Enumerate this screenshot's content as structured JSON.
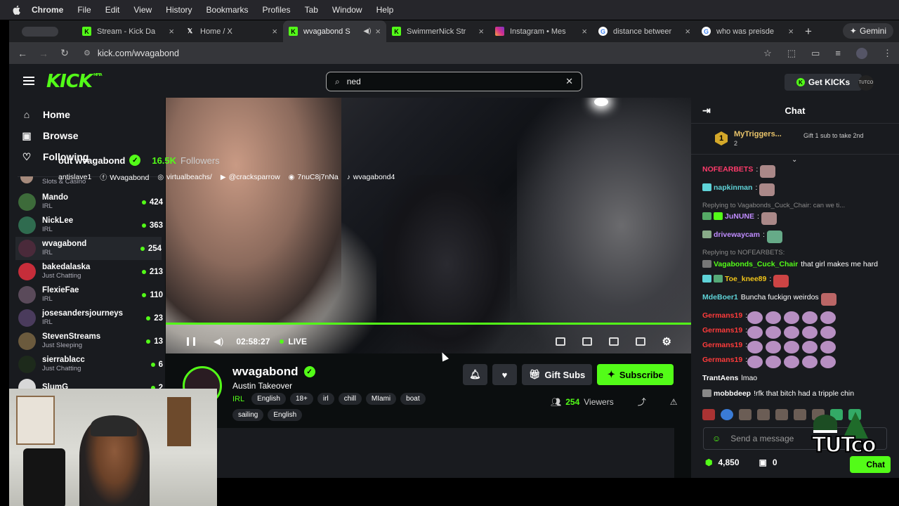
{
  "menubar": {
    "app": "Chrome",
    "items": [
      "File",
      "Edit",
      "View",
      "History",
      "Bookmarks",
      "Profiles",
      "Tab",
      "Window",
      "Help"
    ]
  },
  "tabs": [
    {
      "title": "Stream - Kick Da",
      "icon": "kick-icon",
      "active": false
    },
    {
      "title": "Home / X",
      "icon": "x-icon",
      "active": false
    },
    {
      "title": "wvagabond S",
      "icon": "kick-icon",
      "active": true
    },
    {
      "title": "SwimmerNick Str",
      "icon": "kick-icon",
      "active": false
    },
    {
      "title": "Instagram • Mes",
      "icon": "instagram-icon",
      "active": false
    },
    {
      "title": "distance betweer",
      "icon": "google-icon",
      "active": false
    },
    {
      "title": "who was preisde",
      "icon": "google-icon",
      "active": false
    }
  ],
  "gemini_label": "Gemini",
  "address": {
    "url": "kick.com/wvagabond"
  },
  "header": {
    "logo": "KICK",
    "logo_sup": "MPTA",
    "search_value": "ned",
    "get_kicks": "Get KICKs",
    "avatar_text": "TUTCO"
  },
  "sidebar": {
    "nav": [
      {
        "label": "Home",
        "icon": "home-icon"
      },
      {
        "label": "Browse",
        "icon": "browse-icon"
      },
      {
        "label": "Following",
        "icon": "heart-icon"
      }
    ],
    "partial_category": "Slots & Casino",
    "channels": [
      {
        "name": "Mando",
        "category": "IRL",
        "viewers": "424",
        "color": "#3d6b3a"
      },
      {
        "name": "NickLee",
        "category": "IRL",
        "viewers": "363",
        "color": "#2f6b4f"
      },
      {
        "name": "wvagabond",
        "category": "IRL",
        "viewers": "254",
        "color": "#4a2a3a"
      },
      {
        "name": "bakedalaska",
        "category": "Just Chatting",
        "viewers": "213",
        "color": "#c62d3a"
      },
      {
        "name": "FlexieFae",
        "category": "IRL",
        "viewers": "110",
        "color": "#5a4a5a"
      },
      {
        "name": "josesandersjourneys",
        "category": "IRL",
        "viewers": "23",
        "color": "#4a3b5c"
      },
      {
        "name": "StevenStreams",
        "category": "Just Sleeping",
        "viewers": "13",
        "color": "#6b5a3d"
      },
      {
        "name": "sierrablacc",
        "category": "Just Chatting",
        "viewers": "6",
        "color": "#1d2a1b"
      },
      {
        "name": "SlumG",
        "category": "",
        "viewers": "2",
        "color": "#d8d8d8"
      }
    ]
  },
  "player": {
    "time": "02:58:27",
    "live": "LIVE"
  },
  "stream": {
    "channel": "wvagabond",
    "title": "Austin Takeover",
    "category": "IRL",
    "tags": [
      "English",
      "18+",
      "irl",
      "chill",
      "MIami",
      "boat"
    ],
    "tags2": [
      "sailing",
      "English"
    ],
    "gift_subs": "Gift Subs",
    "subscribe": "Subscribe",
    "viewers": "254",
    "viewers_label": "Viewers"
  },
  "about": {
    "title": "out wvagabond",
    "followers": "16.5K",
    "followers_label": "Followers",
    "socials": [
      {
        "icon": "link-icon",
        "text": "antislave1"
      },
      {
        "icon": "facebook-icon",
        "text": "Wvagabond"
      },
      {
        "icon": "instagram-icon",
        "text": "virtualbeachs/"
      },
      {
        "icon": "youtube-icon",
        "text": "@cracksparrow"
      },
      {
        "icon": "discord-icon",
        "text": "7nuC8j7nNa"
      },
      {
        "icon": "tiktok-icon",
        "text": "wvagabond4"
      }
    ]
  },
  "chat": {
    "title": "Chat",
    "pinned": {
      "rank": "1",
      "user": "MyTriggers...",
      "count": "2",
      "gift": "Gift 1 sub to take 2nd"
    },
    "messages": [
      {
        "user": "NOFEARBETS",
        "color": "#ff3b6b",
        "text": "",
        "reply": "",
        "emote": true
      },
      {
        "user": "napkinman",
        "color": "#5fd3d8",
        "text": "",
        "reply": "",
        "emote": true
      },
      {
        "user": "JuNUNE",
        "color": "#c08cff",
        "text": "",
        "reply": "Replying to Vagabonds_Cuck_Chair: can we ti...",
        "emote": true
      },
      {
        "user": "drivewaycam",
        "color": "#c08cff",
        "text": "",
        "reply": "",
        "emote": true
      },
      {
        "user": "Vagabonds_Cuck_Chair",
        "color": "#53fc18",
        "text": "that girl makes me hard",
        "reply": "Replying to NOFEARBETS:",
        "emote": false
      },
      {
        "user": "Toe_knee89",
        "color": "#f0c419",
        "text": "",
        "reply": "",
        "emote": true
      },
      {
        "user": "MdeBoer1",
        "color": "#5fd3d8",
        "text": "Buncha fuckign weirdos",
        "reply": "",
        "emote": true
      },
      {
        "user": "Germans19",
        "color": "#ff3b3b",
        "text": "",
        "reply": "",
        "emote": false,
        "row": true
      },
      {
        "user": "Germans19",
        "color": "#ff3b3b",
        "text": "",
        "reply": "",
        "emote": false,
        "row": true
      },
      {
        "user": "Germans19",
        "color": "#ff3b3b",
        "text": "",
        "reply": "",
        "emote": false,
        "row": true
      },
      {
        "user": "Germans19",
        "color": "#ff3b3b",
        "text": "",
        "reply": "",
        "emote": false,
        "row": true
      },
      {
        "user": "TrantAens",
        "color": "#ffffff",
        "text": "lmao",
        "reply": "",
        "emote": false
      },
      {
        "user": "mobbdeep",
        "color": "#ffffff",
        "text": "!rfk that bitch had a tripple chin",
        "reply": "",
        "emote": false
      }
    ],
    "input_placeholder": "Send a message",
    "kicks": "4,850",
    "points": "0",
    "chat_button": "Chat",
    "overlay_text": "TUTco"
  },
  "colors": {
    "accent": "#53fc18",
    "bg": "#0b0e0f",
    "panel": "#191b1f"
  }
}
